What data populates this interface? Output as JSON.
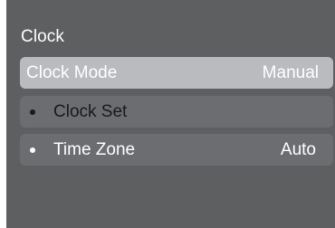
{
  "panel": {
    "title": "Clock",
    "items": [
      {
        "label": "Clock Mode",
        "value": "Manual",
        "selected": true,
        "bullet": false
      },
      {
        "label": "Clock Set",
        "value": "",
        "selected": false,
        "bullet": true
      },
      {
        "label": "Time Zone",
        "value": "Auto",
        "selected": false,
        "bullet": true
      }
    ]
  },
  "colors": {
    "panel_bg": "#5e5f61",
    "selected_bg": "#b9bbbe",
    "item_bg": "#6c6d70",
    "text": "#ffffff",
    "dim_text": "#1a1a1a"
  }
}
